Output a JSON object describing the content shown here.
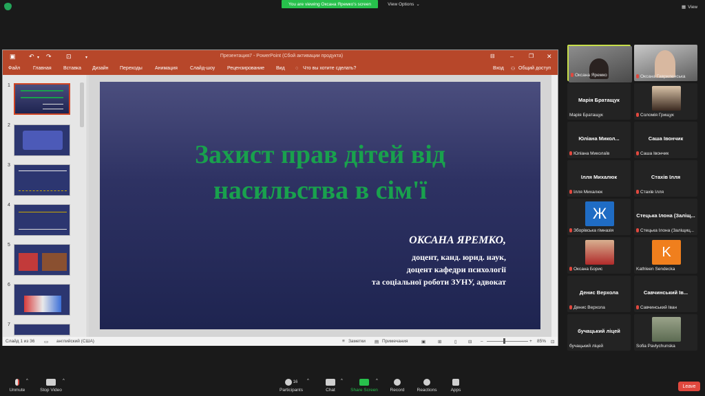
{
  "zoom": {
    "viewing_banner": "You are viewing Оксана Яремко's screen",
    "view_options": "View Options",
    "view_button": "View",
    "toolbar": {
      "unmute": "Unmute",
      "stop_video": "Stop Video",
      "participants": "Participants",
      "participants_count": "16",
      "chat": "Chat",
      "share_screen": "Share Screen",
      "record": "Record",
      "reactions": "Reactions",
      "apps": "Apps",
      "leave": "Leave"
    }
  },
  "powerpoint": {
    "window_title": "Презентация7 - PowerPoint (Сбой активации продукта)",
    "ribbon_tabs": [
      "Файл",
      "Главная",
      "Вставка",
      "Дизайн",
      "Переходы",
      "Анимация",
      "Слайд-шоу",
      "Рецензирование",
      "Вид"
    ],
    "search_placeholder": "Что вы хотите сделать?",
    "login": "Вход",
    "share": "Общий доступ",
    "slide_numbers": [
      "1",
      "2",
      "3",
      "4",
      "5",
      "6",
      "7"
    ],
    "slide": {
      "title_line1": "Захист прав дітей від",
      "title_line2": "насильства в сім'ї",
      "author": "ОКСАНА ЯРЕМКО,",
      "subtitle_line1": "доцент, канд. юрид. наук,",
      "subtitle_line2": "доцент кафедри психології",
      "subtitle_line3": "та соціальної роботи ЗУНУ, адвокат"
    },
    "status": {
      "slide_counter": "Слайд 1 из 36",
      "language": "английский (США)",
      "notes": "Заметки",
      "comments": "Примечания",
      "zoom": "85%"
    }
  },
  "gallery": [
    {
      "label": "Оксана Яремко",
      "name": ""
    },
    {
      "label": "Оксана Гавриленська",
      "name": ""
    },
    {
      "label": "Марія Братащук",
      "name": "Марія Братащук"
    },
    {
      "label": "Соломія Грищук",
      "name": ""
    },
    {
      "label": "Юліана Миколаїв",
      "name": "Юліана Микол..."
    },
    {
      "label": "Саша Івончик",
      "name": "Саша Івончик"
    },
    {
      "label": "Ілля Михалюк",
      "name": "Ілля Михалюк"
    },
    {
      "label": "Стахів Ілля",
      "name": "Стахів Ілля"
    },
    {
      "label": "Зборівська гімназія",
      "name": "",
      "avatar": "Ж"
    },
    {
      "label": "Стецька Ілона (Заліщиц...",
      "name": "Стецька Ілона (Заліщ..."
    },
    {
      "label": "Оксана Борис",
      "name": ""
    },
    {
      "label": "Kathleen Sendecka",
      "name": "",
      "avatar": "K"
    },
    {
      "label": "Денис Верхола",
      "name": "Денис Верхола"
    },
    {
      "label": "Савчинський Іван",
      "name": "Савчинський Ів..."
    },
    {
      "label": "бучацький ліцей",
      "name": "бучацький ліцей"
    },
    {
      "label": "Sofia Pavlychunska",
      "name": ""
    }
  ],
  "colors": {
    "ppt_accent": "#b7472a",
    "title_green": "#19a14d",
    "active_speaker": "#c8e04a",
    "zoom_green": "#27c14c",
    "leave_red": "#e0483e"
  }
}
